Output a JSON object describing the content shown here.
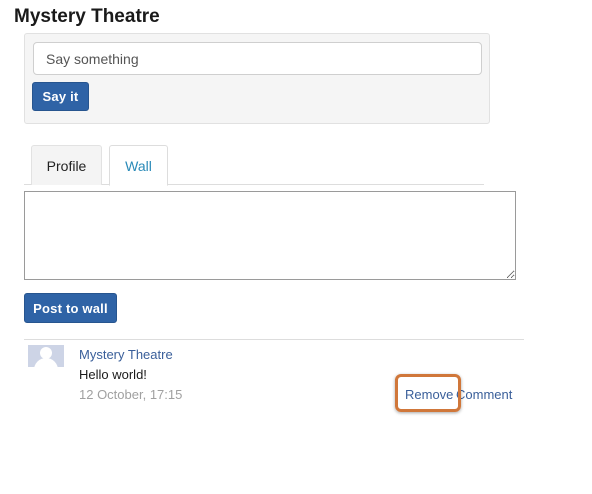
{
  "page": {
    "title": "Mystery Theatre"
  },
  "status": {
    "placeholder": "Say something",
    "button_label": "Say it"
  },
  "tabs": [
    {
      "label": "Profile",
      "active": false
    },
    {
      "label": "Wall",
      "active": true
    }
  ],
  "wall": {
    "textarea_value": "",
    "post_button_label": "Post to wall"
  },
  "posts": [
    {
      "author": "Mystery Theatre",
      "text": "Hello world!",
      "timestamp": "12 October, 17:15",
      "remove_label": "Remove",
      "comment_label": "Comment",
      "avatar_icon": "user-silhouette-icon"
    }
  ],
  "colors": {
    "primary_button": "#2f63a6",
    "link": "#3a5f9a",
    "active_tab": "#2a8ab8",
    "highlight": "#d0773a"
  }
}
